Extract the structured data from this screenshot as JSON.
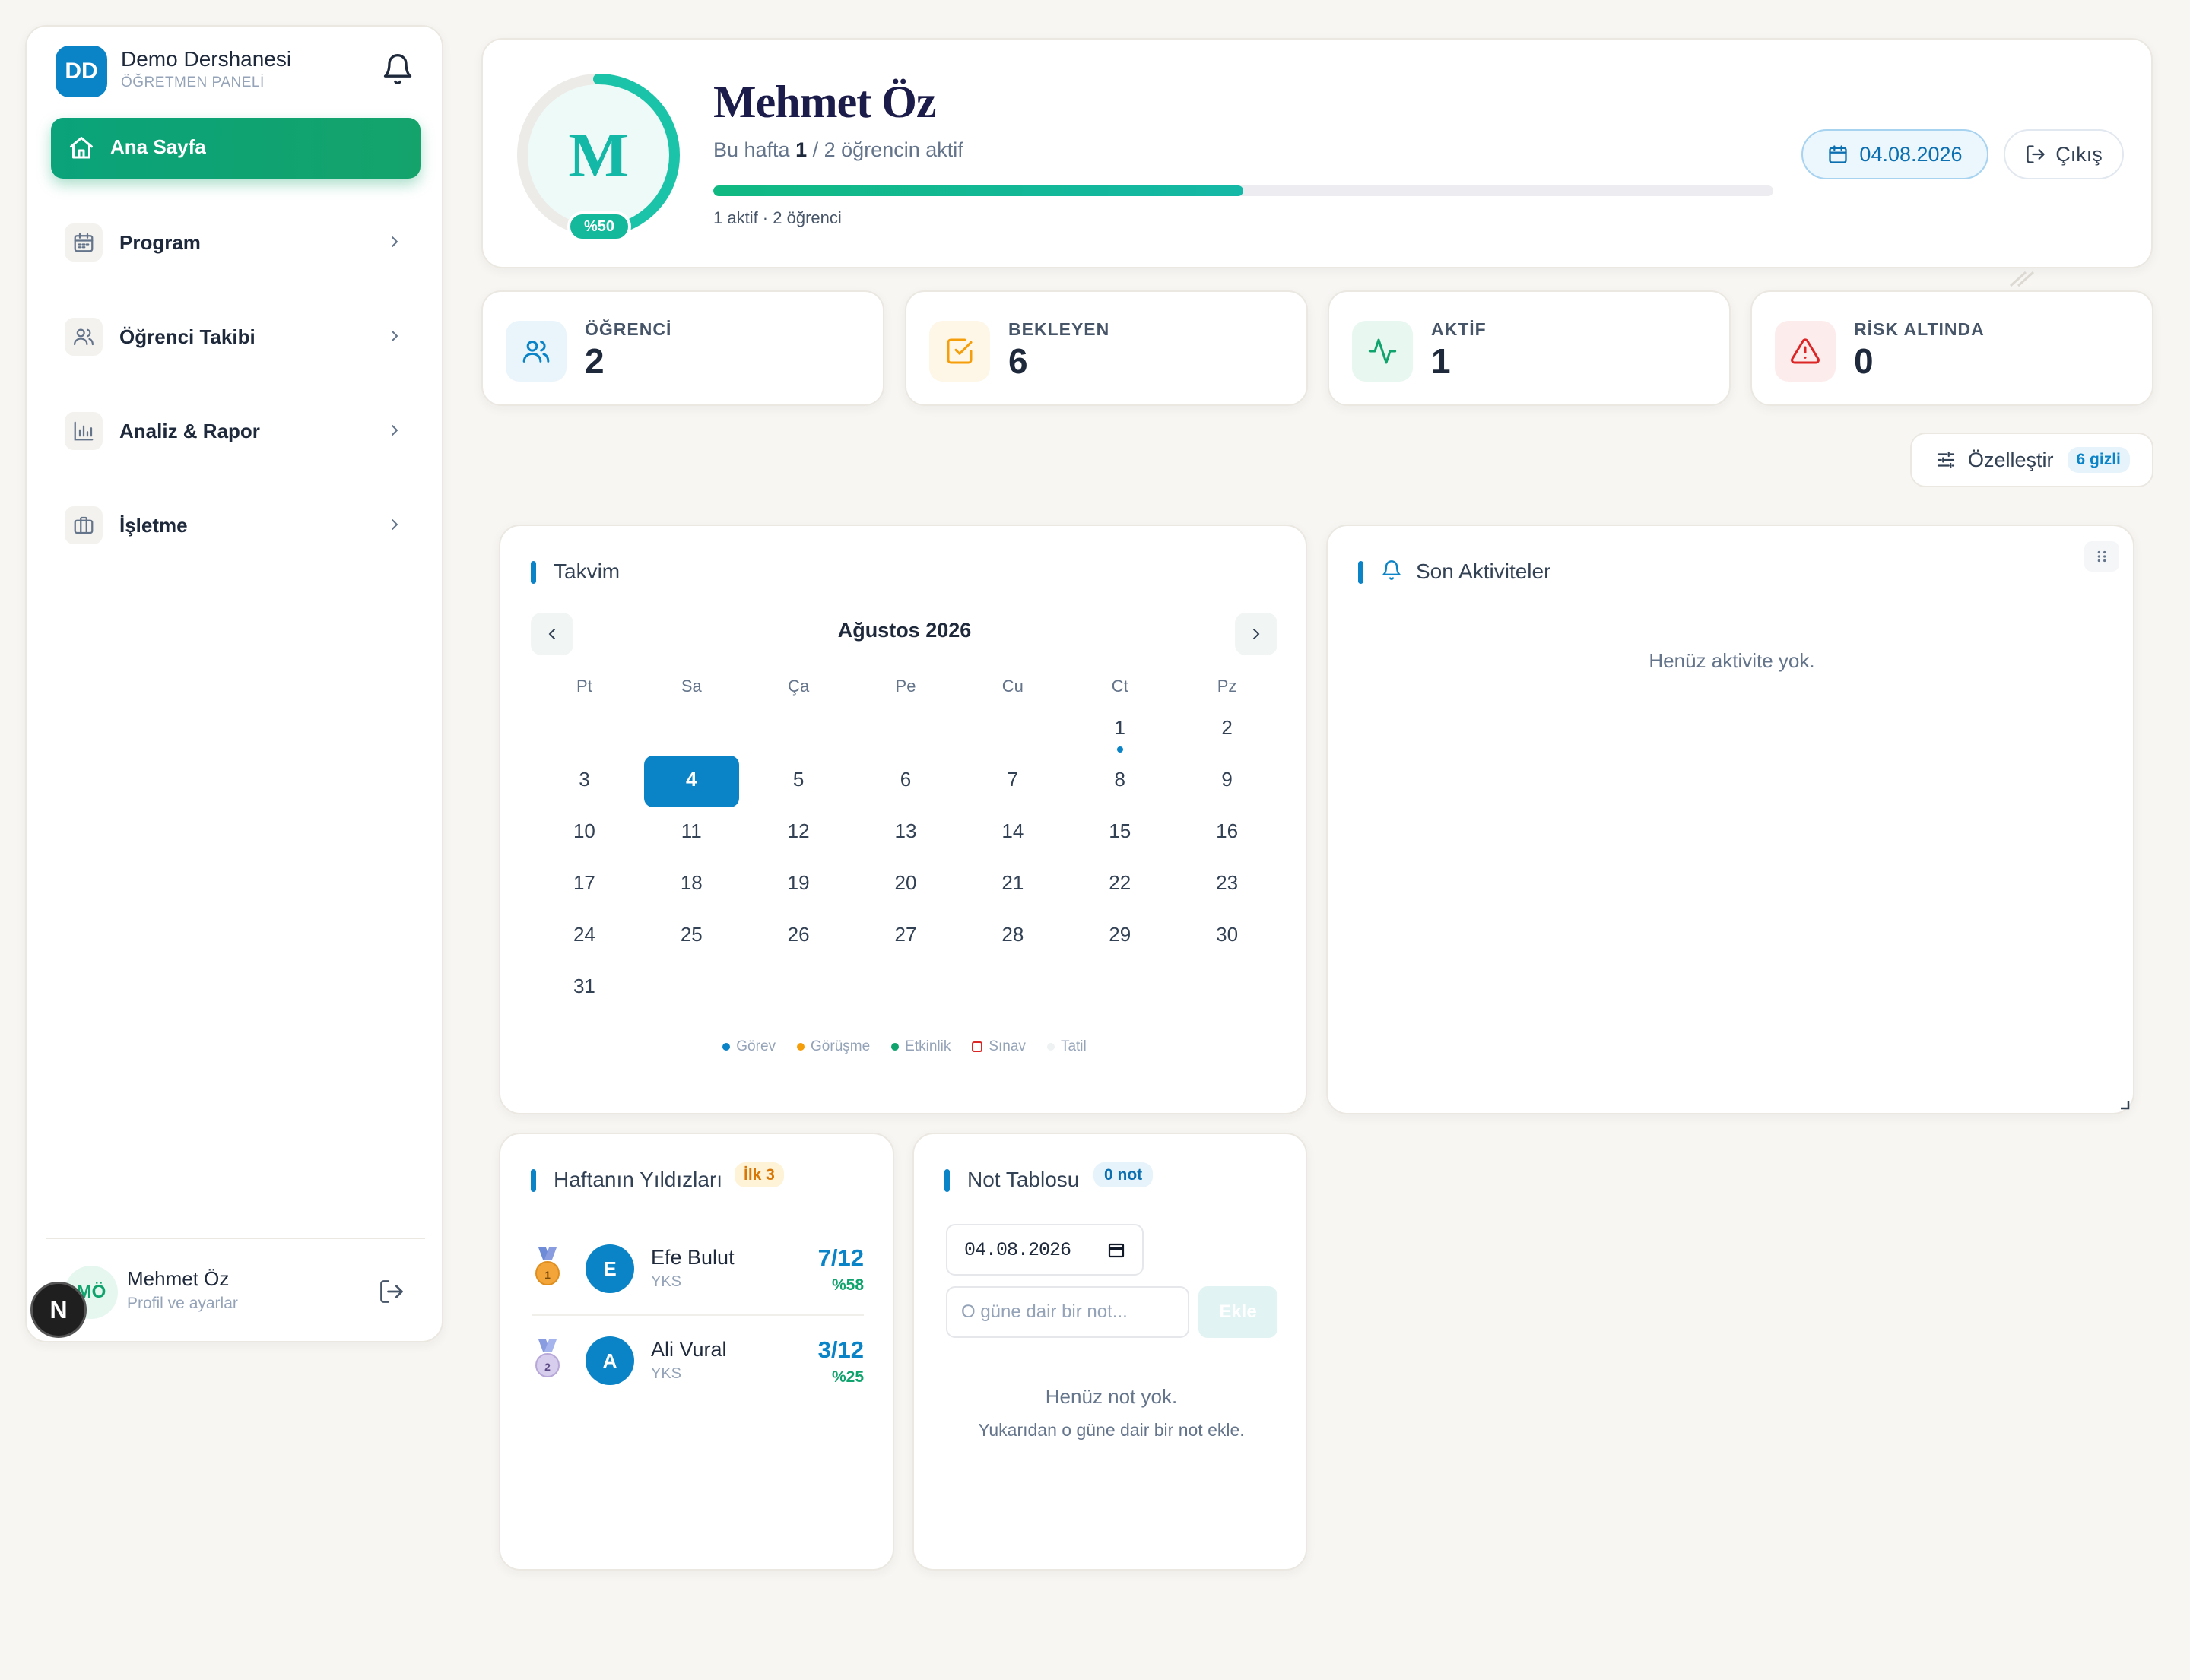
{
  "sidebar": {
    "brand_initials": "DD",
    "brand_name": "Demo Dershanesi",
    "brand_sub": "ÖĞRETMEN PANELİ",
    "home_label": "Ana Sayfa",
    "items": [
      {
        "label": "Program",
        "icon": "calendar-icon"
      },
      {
        "label": "Öğrenci Takibi",
        "icon": "users-icon"
      },
      {
        "label": "Analiz & Rapor",
        "icon": "bar-chart-icon"
      },
      {
        "label": "İşletme",
        "icon": "briefcase-icon"
      }
    ],
    "user_initials": "MÖ",
    "user_name": "Mehmet Öz",
    "user_sub": "Profil ve ayarlar",
    "next_badge": "N"
  },
  "profile": {
    "initial": "M",
    "ring_percent": 50,
    "ring_label": "%50",
    "name": "Mehmet Öz",
    "week_prefix": "Bu hafta",
    "week_active": "1",
    "week_suffix": "/ 2 öğrencin aktif",
    "progress_fraction": 0.5,
    "progress_label": "1 aktif · 2 öğrenci",
    "date": "04.08.2026",
    "logout_label": "Çıkış"
  },
  "stats": [
    {
      "label": "ÖĞRENCİ",
      "value": "2",
      "color": "#0b84c7",
      "bg": "#eaf5fb"
    },
    {
      "label": "BEKLEYEN",
      "value": "6",
      "color": "#f59e0b",
      "bg": "#fef6e6"
    },
    {
      "label": "AKTİF",
      "value": "1",
      "color": "#10a36e",
      "bg": "#e8f7f0"
    },
    {
      "label": "RİSK ALTINDA",
      "value": "0",
      "color": "#dc2626",
      "bg": "#fdecec"
    }
  ],
  "customize": {
    "label": "Özelleştir",
    "badge": "6 gizli"
  },
  "calendar": {
    "title": "Takvim",
    "month": "Ağustos 2026",
    "weekdays": [
      "Pt",
      "Sa",
      "Ça",
      "Pe",
      "Cu",
      "Ct",
      "Pz"
    ],
    "first_weekday_index": 5,
    "days_in_month": 31,
    "today": 4,
    "event_days": [
      1
    ],
    "legend": [
      {
        "label": "Görev",
        "color": "#0b84c7",
        "shape": "dot"
      },
      {
        "label": "Görüşme",
        "color": "#f59e0b",
        "shape": "dot"
      },
      {
        "label": "Etkinlik",
        "color": "#10a36e",
        "shape": "dot"
      },
      {
        "label": "Sınav",
        "color": "#dc2626",
        "shape": "square"
      },
      {
        "label": "Tatil",
        "color": "#eef2f3",
        "shape": "dot"
      }
    ]
  },
  "activities": {
    "title": "Son Aktiviteler",
    "empty": "Henüz aktivite yok."
  },
  "stars": {
    "title": "Haftanın Yıldızları",
    "tag": "İlk 3",
    "rows": [
      {
        "rank": "1",
        "initial": "E",
        "name": "Efe Bulut",
        "sub": "YKS",
        "score": "7/12",
        "pct": "%58",
        "medal_color": "#f4a53a",
        "ribbon_color": "#6d8bd6"
      },
      {
        "rank": "2",
        "initial": "A",
        "name": "Ali Vural",
        "sub": "YKS",
        "score": "3/12",
        "pct": "%25",
        "medal_color": "#c4b5e0",
        "ribbon_color": "#8a9ce0"
      }
    ]
  },
  "notes": {
    "title": "Not Tablosu",
    "tag": "0 not",
    "date_value": "04.08.2026",
    "placeholder": "O güne dair bir not...",
    "add_label": "Ekle",
    "empty1": "Henüz not yok.",
    "empty2": "Yukarıdan o güne dair bir not ekle."
  }
}
